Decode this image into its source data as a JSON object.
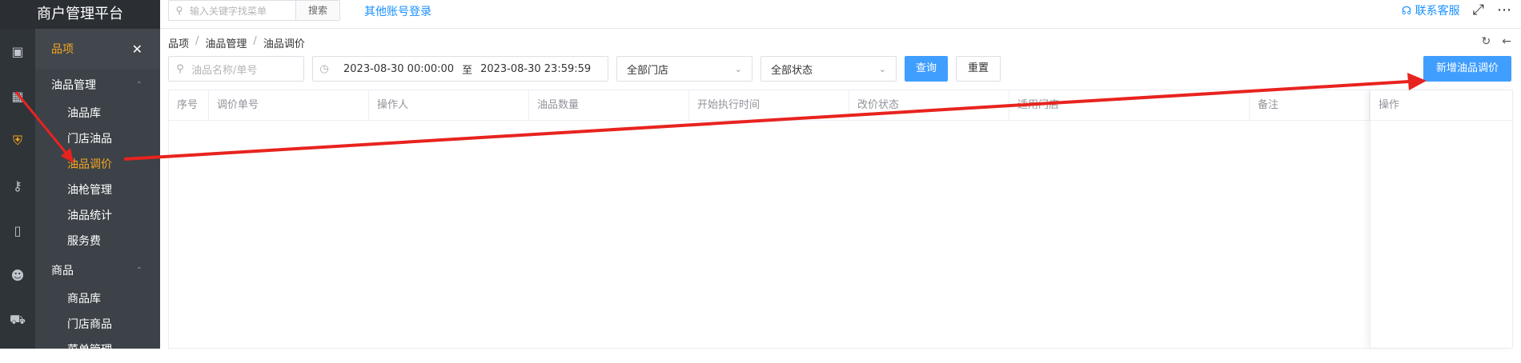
{
  "app": {
    "title": "商户管理平台"
  },
  "topbar": {
    "search_placeholder": "输入关键字找菜单",
    "search_button": "搜索",
    "other_login": "其他账号登录",
    "contact": "联系客服"
  },
  "sidebar": {
    "header": "品项",
    "groups": [
      {
        "label": "油品管理",
        "items": [
          "油品库",
          "门店油品",
          "油品调价",
          "油枪管理",
          "油品统计",
          "服务费"
        ]
      },
      {
        "label": "商品",
        "items": [
          "商品库",
          "门店商品",
          "菜单管理"
        ]
      }
    ],
    "active_item": "油品调价"
  },
  "breadcrumb": [
    "品项",
    "油品管理",
    "油品调价"
  ],
  "filters": {
    "keyword_placeholder": "油品名称/单号",
    "date_start": "2023-08-30 00:00:00",
    "date_sep": "至",
    "date_end": "2023-08-30 23:59:59",
    "store_select": "全部门店",
    "status_select": "全部状态",
    "query_button": "查询",
    "reset_button": "重置",
    "add_button": "新增油品调价"
  },
  "table": {
    "columns": [
      "序号",
      "调价单号",
      "操作人",
      "油品数量",
      "开始执行时间",
      "改价状态",
      "适用门店",
      "备注"
    ],
    "action_column": "操作",
    "rows": []
  },
  "colors": {
    "accent": "#f5a623",
    "primary": "#409eff",
    "arrow": "#e8231f"
  }
}
